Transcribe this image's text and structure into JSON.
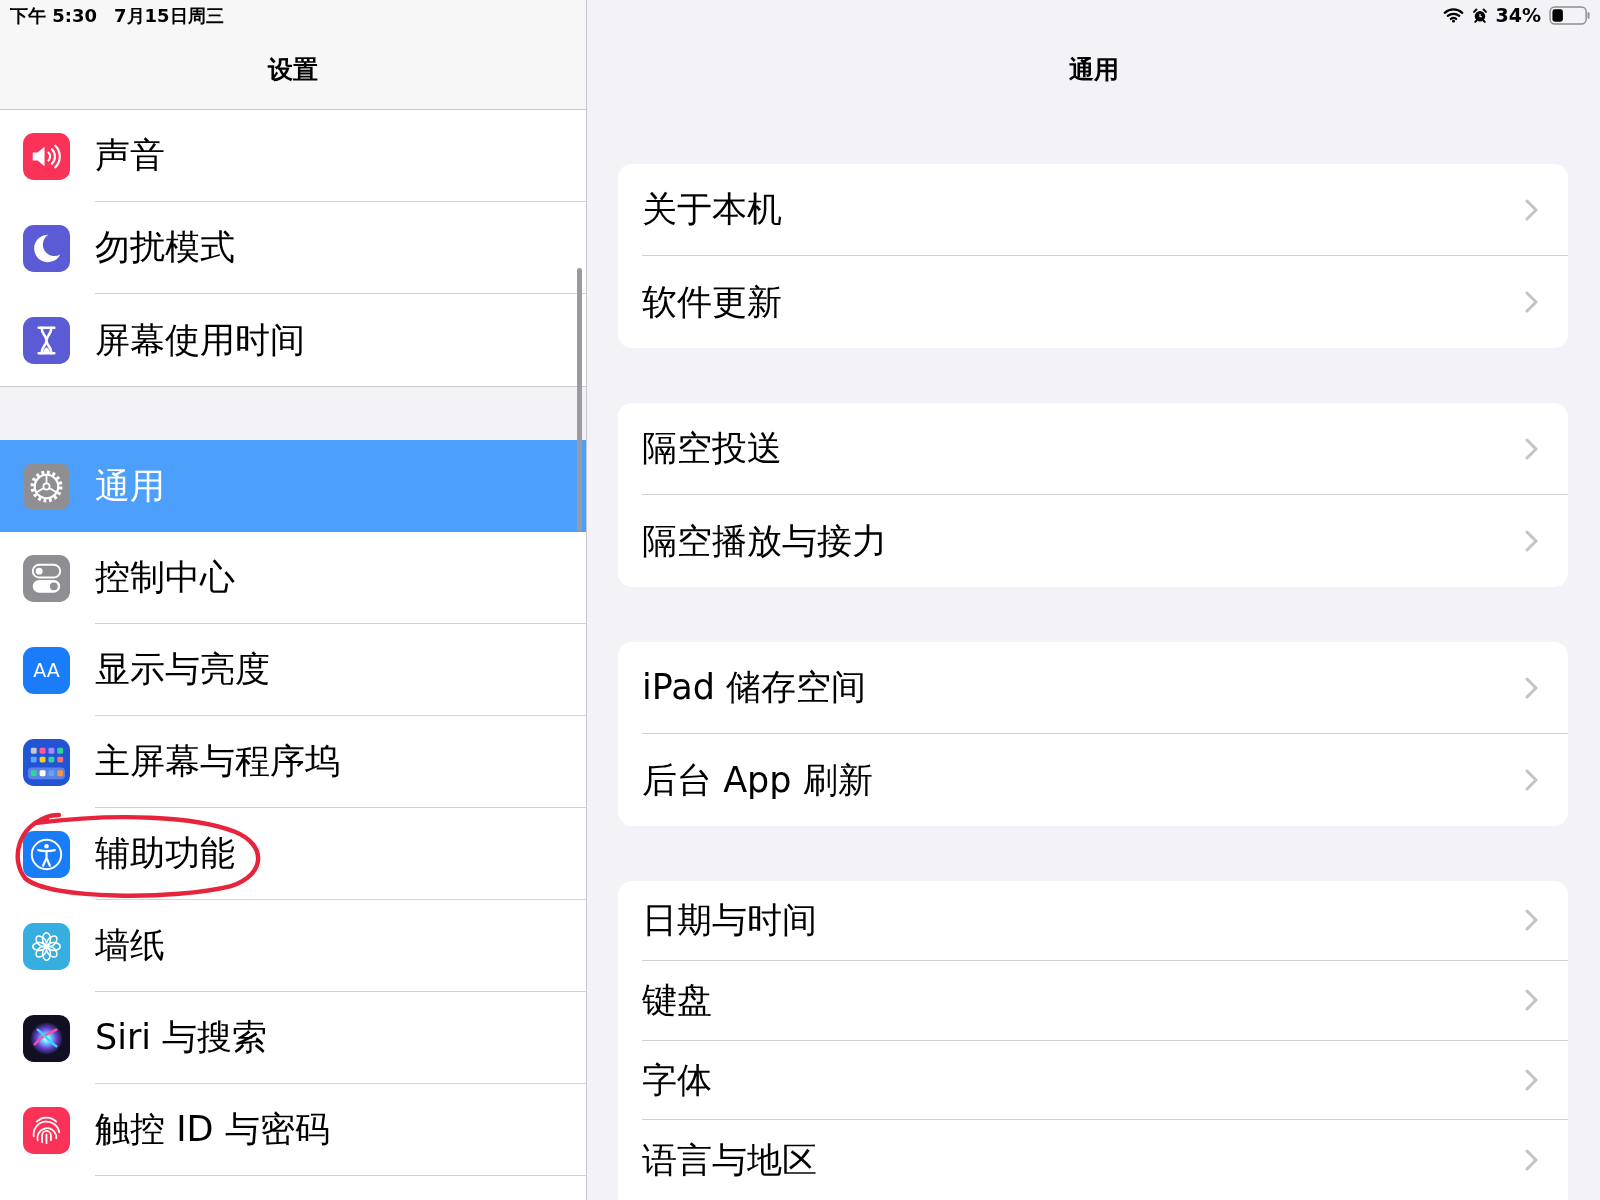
{
  "status_bar": {
    "time": "下午 5:30",
    "date": "7月15日周三",
    "battery": "34%"
  },
  "sidebar": {
    "title": "设置",
    "groups": [
      {
        "items": [
          {
            "label": "声音",
            "selected": false,
            "circled": false
          },
          {
            "label": "勿扰模式",
            "selected": false,
            "circled": false
          },
          {
            "label": "屏幕使用时间",
            "selected": false,
            "circled": false
          }
        ]
      },
      {
        "items": [
          {
            "label": "通用",
            "selected": true,
            "circled": false
          },
          {
            "label": "控制中心",
            "selected": false,
            "circled": false
          },
          {
            "label": "显示与亮度",
            "icon_text": "AA",
            "selected": false,
            "circled": false
          },
          {
            "label": "主屏幕与程序坞",
            "selected": false,
            "circled": false
          },
          {
            "label": "辅助功能",
            "selected": false,
            "circled": true
          },
          {
            "label": "墙纸",
            "selected": false,
            "circled": false
          },
          {
            "label": "Siri 与搜索",
            "selected": false,
            "circled": false
          },
          {
            "label": "触控 ID 与密码",
            "selected": false,
            "circled": false
          }
        ]
      }
    ]
  },
  "detail": {
    "title": "通用",
    "groups": [
      {
        "rows": [
          {
            "label": "关于本机"
          },
          {
            "label": "软件更新"
          }
        ]
      },
      {
        "rows": [
          {
            "label": "隔空投送"
          },
          {
            "label": "隔空播放与接力"
          }
        ]
      },
      {
        "rows": [
          {
            "label": "iPad 储存空间"
          },
          {
            "label": "后台 App 刷新"
          }
        ]
      },
      {
        "rows": [
          {
            "label": "日期与时间"
          },
          {
            "label": "键盘"
          },
          {
            "label": "字体"
          },
          {
            "label": "语言与地区"
          }
        ]
      }
    ]
  }
}
